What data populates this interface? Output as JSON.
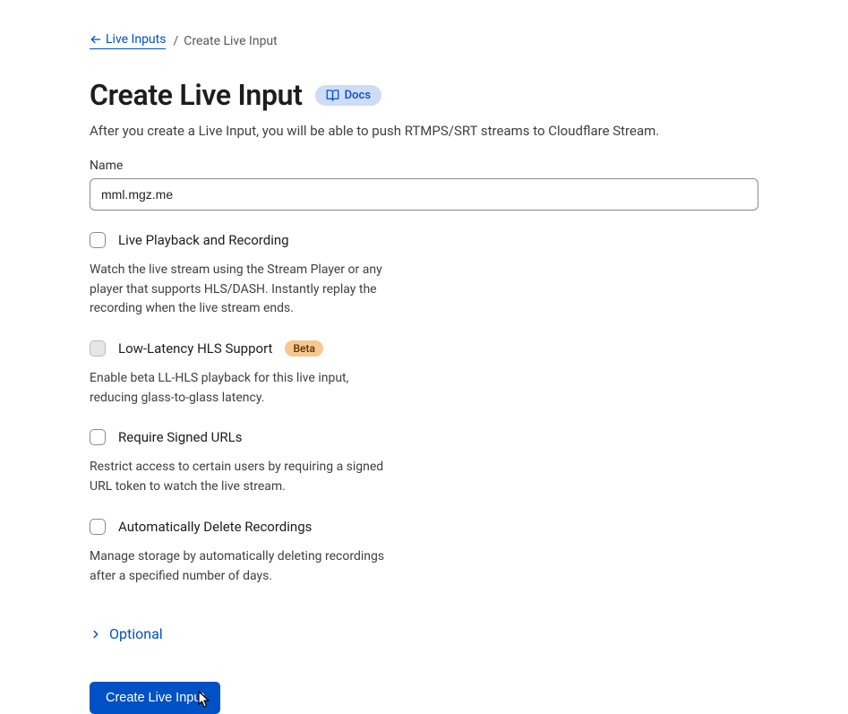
{
  "breadcrumb": {
    "parent": "Live Inputs",
    "current": "Create Live Input"
  },
  "title": "Create Live Input",
  "docs_label": "Docs",
  "subtitle": "After you create a Live Input, you will be able to push RTMPS/SRT streams to Cloudflare Stream.",
  "name_field": {
    "label": "Name",
    "value": "mml.mgz.me"
  },
  "options": {
    "live_playback": {
      "label": "Live Playback and Recording",
      "desc": "Watch the live stream using the Stream Player or any player that supports HLS/DASH. Instantly replay the recording when the live stream ends."
    },
    "ll_hls": {
      "label": "Low-Latency HLS Support",
      "badge": "Beta",
      "desc": "Enable beta LL-HLS playback for this live input, reducing glass-to-glass latency."
    },
    "signed_urls": {
      "label": "Require Signed URLs",
      "desc": "Restrict access to certain users by requiring a signed URL token to watch the live stream."
    },
    "auto_delete": {
      "label": "Automatically Delete Recordings",
      "desc": "Manage storage by automatically deleting recordings after a specified number of days."
    }
  },
  "optional_label": "Optional",
  "submit_label": "Create Live Input"
}
